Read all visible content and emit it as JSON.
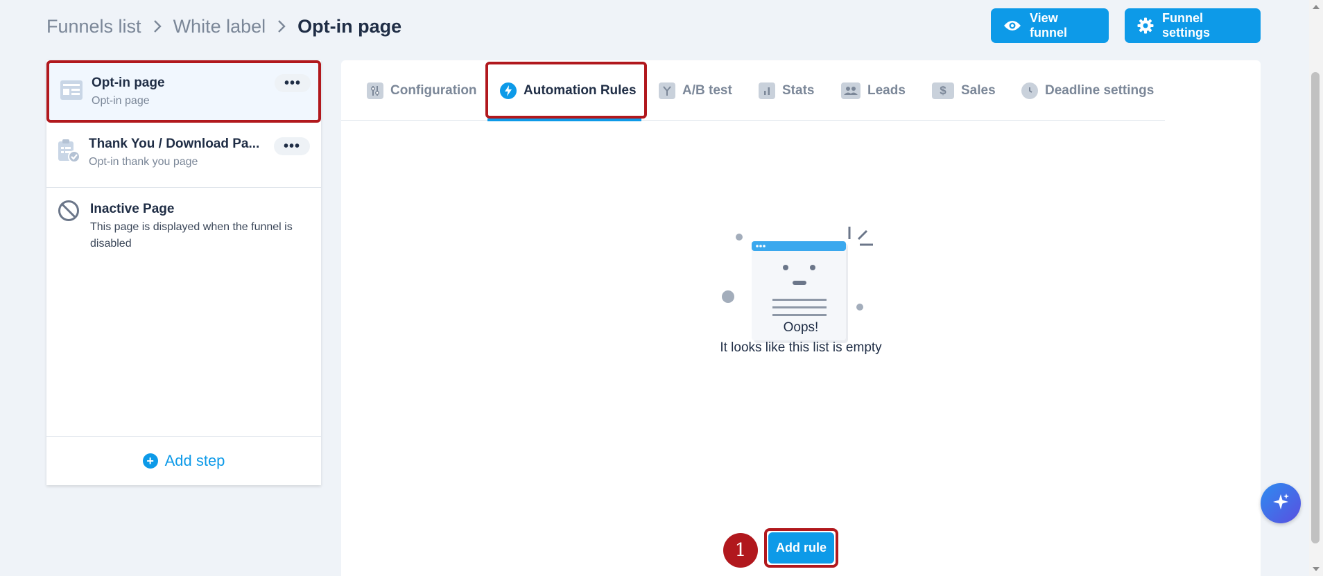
{
  "breadcrumb": {
    "items": [
      "Funnels list",
      "White label"
    ],
    "current": "Opt-in page"
  },
  "header": {
    "view_funnel_label": "View funnel",
    "funnel_settings_label": "Funnel settings"
  },
  "sidebar": {
    "steps": [
      {
        "title": "Opt-in page",
        "subtitle": "Opt-in page",
        "icon": "page-layout-icon",
        "selected": true
      },
      {
        "title": "Thank You / Download Pa...",
        "subtitle": "Opt-in thank you page",
        "icon": "clipboard-check-icon",
        "selected": false
      },
      {
        "title": "Inactive Page",
        "description": "This page is displayed when the funnel is disabled",
        "icon": "prohibited-icon"
      }
    ],
    "more_label": "•••",
    "add_step_label": "Add step"
  },
  "tabs": [
    {
      "label": "Configuration",
      "icon": "sliders-icon"
    },
    {
      "label": "Automation Rules",
      "icon": "lightning-icon",
      "active": true
    },
    {
      "label": "A/B test",
      "icon": "split-icon"
    },
    {
      "label": "Stats",
      "icon": "bar-chart-icon"
    },
    {
      "label": "Leads",
      "icon": "people-icon"
    },
    {
      "label": "Sales",
      "icon": "dollar-icon"
    },
    {
      "label": "Deadline settings",
      "icon": "clock-icon"
    }
  ],
  "empty_state": {
    "line1": "Oops!",
    "line2": "It looks like this list is empty"
  },
  "actions": {
    "add_rule_label": "Add rule",
    "step_marker": "1"
  },
  "colors": {
    "primary": "#0d9ae8",
    "highlight": "#b1181d",
    "text": "#1f2d45",
    "muted": "#7b8798",
    "background": "#eff3f8"
  }
}
